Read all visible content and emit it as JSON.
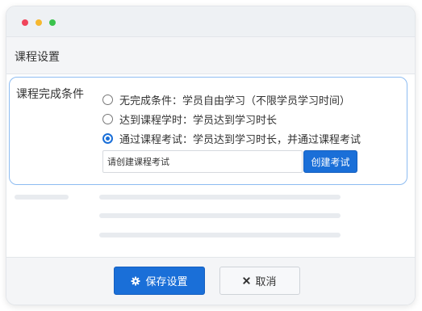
{
  "header": {
    "title": "课程设置"
  },
  "completion": {
    "label": "课程完成条件",
    "options": [
      {
        "label": "无完成条件：学员自由学习（不限学员学习时间）",
        "checked": false
      },
      {
        "label": "达到课程学时：学员达到学习时长",
        "checked": false
      },
      {
        "label": "通过课程考试：学员达到学习时长，并通过课程考试",
        "checked": true
      }
    ],
    "exam_input_value": "请创建课程考试",
    "create_exam_label": "创建考试"
  },
  "footer": {
    "save_label": "保存设置",
    "cancel_label": "取消"
  },
  "icons": {
    "save": "gear-icon",
    "cancel": "close-icon"
  },
  "colors": {
    "accent": "#1a6fd8",
    "panel_border": "#8ebcf1",
    "traffic_red": "#f0455b",
    "traffic_yellow": "#f6b830",
    "traffic_green": "#3ac34c"
  }
}
